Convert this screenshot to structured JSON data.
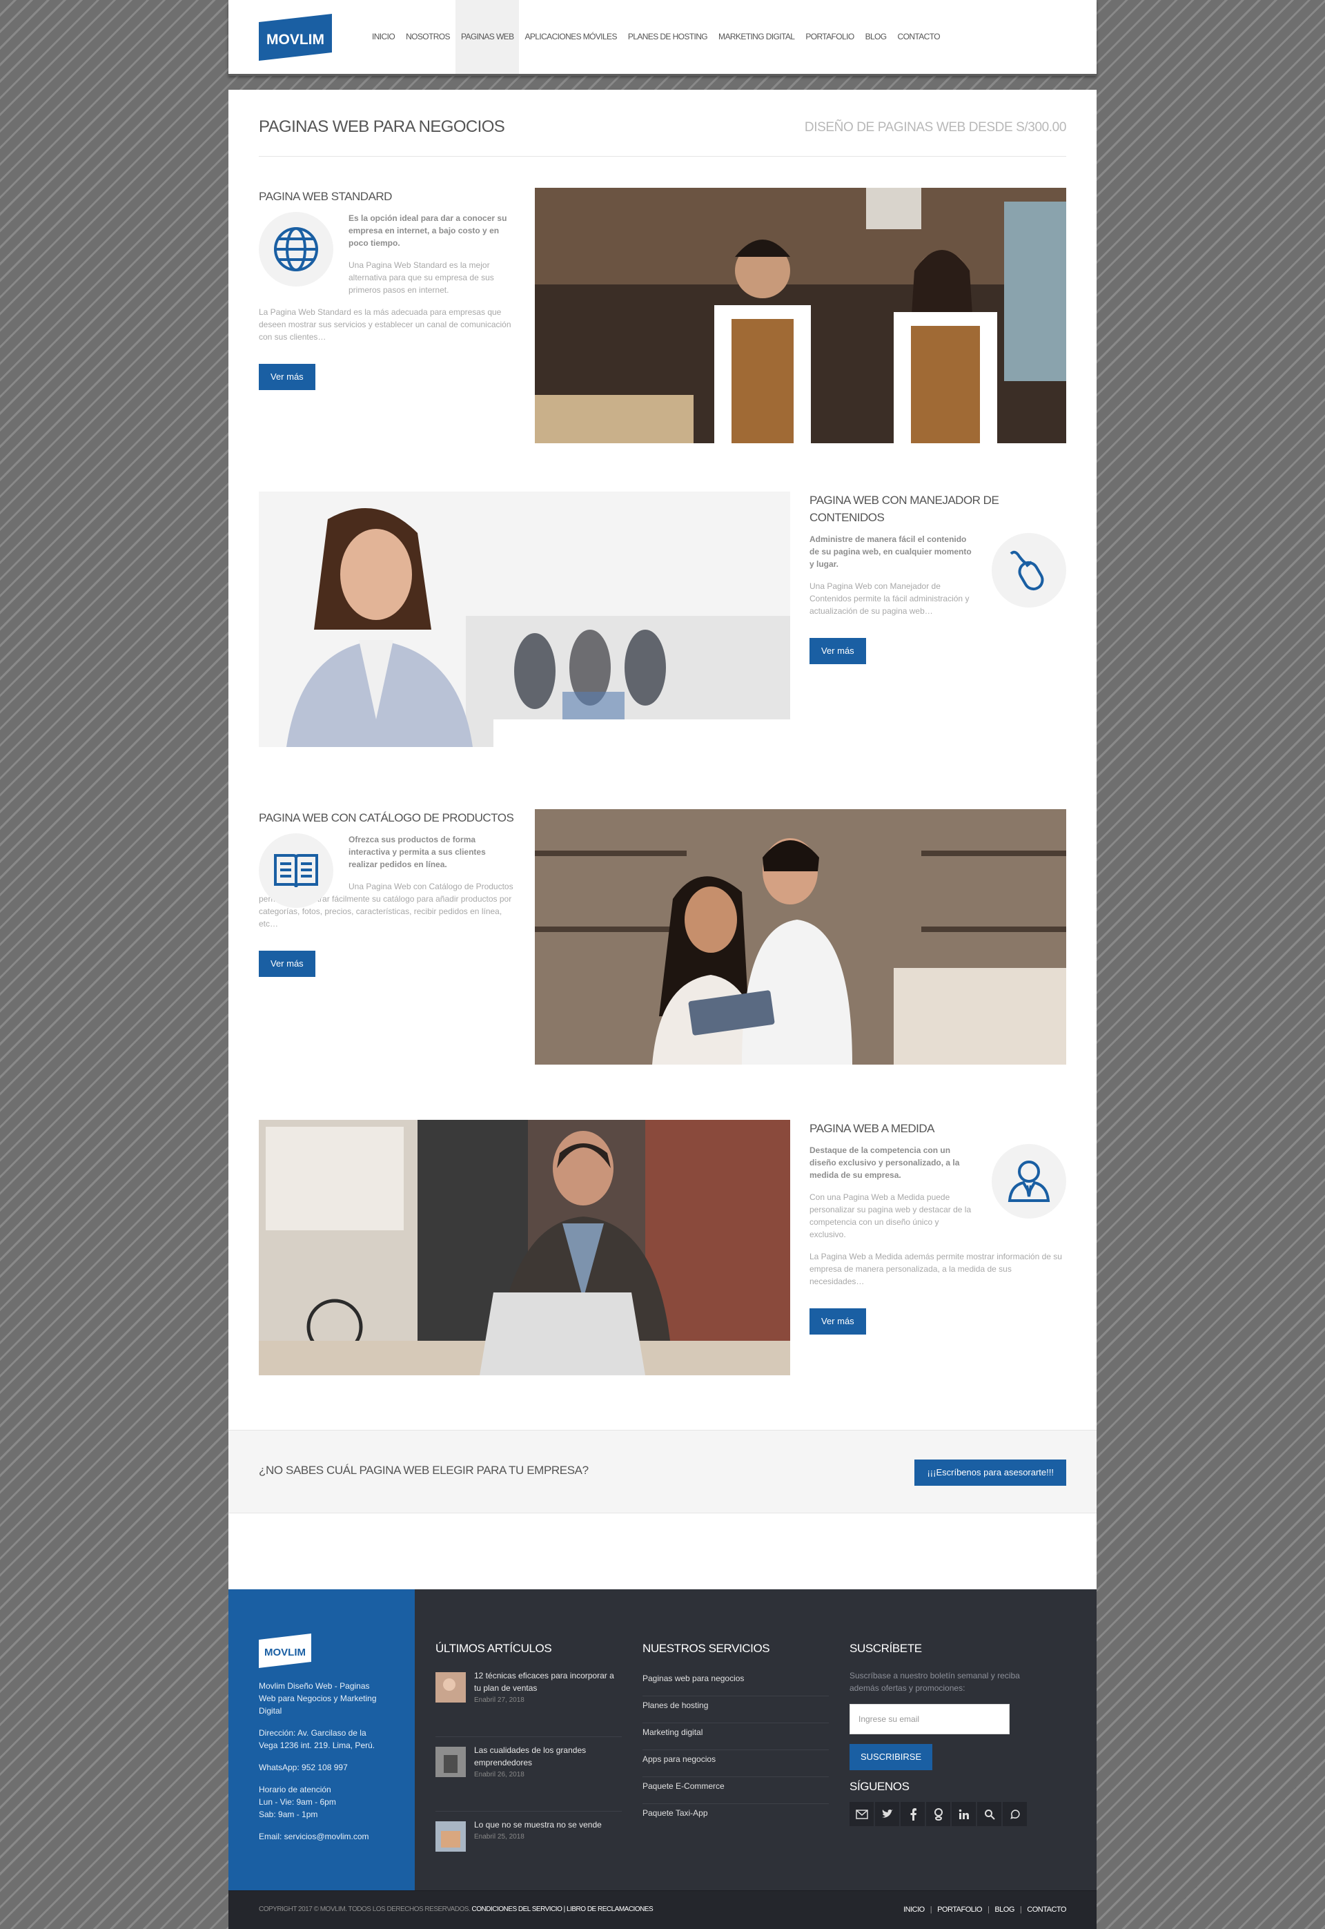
{
  "colors": {
    "brand_blue": "#1a5fa3",
    "footer_dark": "#2e3138",
    "bar_gray": "#f5f5f5"
  },
  "brand": {
    "logo_text": "MOVLIM"
  },
  "nav": {
    "items": [
      "INICIO",
      "NOSOTROS",
      "PAGINAS WEB",
      "APLICACIONES MÓVILES",
      "PLANES DE HOSTING",
      "MARKETING DIGITAL",
      "PORTAFOLIO",
      "BLOG",
      "CONTACTO"
    ],
    "active_index": 2
  },
  "page": {
    "title": "PAGINAS WEB PARA NEGOCIOS",
    "subtitle": "DISEÑO DE PAGINAS WEB DESDE S/300.00"
  },
  "sections": [
    {
      "title": "PAGINA WEB STANDARD",
      "icon": "globe-icon",
      "lead": "Es la opción ideal para dar a conocer su empresa en internet, a bajo costo y en poco tiempo.",
      "desc1": "Una Pagina Web Standard es la mejor alternativa para que su empresa de sus primeros pasos en internet.",
      "desc2": "La Pagina Web Standard es la más adecuada para empresas que deseen mostrar sus servicios y establecer un canal de comunicación con sus clientes…",
      "button": "Ver más"
    },
    {
      "title": "PAGINA WEB CON MANEJADOR DE CONTENIDOS",
      "icon": "mouse-icon",
      "lead": "Administre de manera fácil el contenido de su pagina web, en cualquier momento y lugar.",
      "desc1": "Una Pagina Web con Manejador de Contenidos permite la fácil administración y actualización de su pagina web…",
      "button": "Ver más"
    },
    {
      "title": "PAGINA WEB CON CATÁLOGO DE PRODUCTOS",
      "icon": "book-icon",
      "lead": "Ofrezca sus productos de forma interactiva y permita a sus clientes realizar pedidos en línea.",
      "desc1": "Una Pagina Web con Catálogo de Productos permite administrar fácilmente su catálogo para añadir productos por categorías, fotos, precios, características, recibir pedidos en línea, etc…",
      "button": "Ver más"
    },
    {
      "title": "PAGINA WEB A MEDIDA",
      "icon": "user-tie-icon",
      "lead": "Destaque de la competencia con un diseño exclusivo y personalizado, a la medida de su empresa.",
      "desc1": "Con una Pagina Web a Medida puede personalizar su pagina web y destacar de la competencia con un diseño único y exclusivo.",
      "desc2": "La Pagina Web a Medida además permite mostrar información de su empresa de manera personalizada, a la medida de sus necesidades…",
      "button": "Ver más"
    }
  ],
  "cta": {
    "text": "¿NO SABES CUÁL PAGINA WEB ELEGIR PARA TU EMPRESA?",
    "button": "¡¡¡Escríbenos para asesorarte!!!"
  },
  "footer": {
    "brand_text": "Movlim Diseño Web - Paginas Web para Negocios y Marketing Digital",
    "address": "Dirección: Av. Garcilaso de la Vega 1236 int. 219. Lima, Perú.",
    "whatsapp": "WhatsApp: 952 108 997",
    "hours_title": "Horario de atención",
    "hours_1": "Lun - Vie: 9am - 6pm",
    "hours_2": "Sab: 9am - 1pm",
    "email": "Email: servicios@movlim.com",
    "articles_heading": "ÚLTIMOS ARTÍCULOS",
    "articles": [
      {
        "title": "12 técnicas eficaces para incorporar a tu plan de ventas",
        "date": "Enabril 27, 2018"
      },
      {
        "title": "Las cualidades de los grandes emprendedores",
        "date": "Enabril 26, 2018"
      },
      {
        "title": "Lo que no se muestra no se vende",
        "date": "Enabril 25, 2018"
      }
    ],
    "services_heading": "NUESTROS SERVICIOS",
    "services": [
      "Paginas web para negocios",
      "Planes de hosting",
      "Marketing digital",
      "Apps para negocios",
      "Paquete E-Commerce",
      "Paquete Taxi-App"
    ],
    "subscribe_heading": "SUSCRÍBETE",
    "subscribe_text": "Suscríbase a nuestro boletín semanal y reciba además ofertas y promociones:",
    "email_placeholder": "Ingrese su email",
    "subscribe_button": "SUSCRIBIRSE",
    "follow_heading": "SÍGUENOS",
    "social_icons": [
      "mail-icon",
      "twitter-icon",
      "facebook-icon",
      "google-plus-icon",
      "linkedin-icon",
      "search-icon",
      "whatsapp-icon"
    ]
  },
  "copyright": {
    "text": "COPYRIGHT 2017 © MOVLIM. TODOS LOS DERECHOS RESERVADOS.",
    "link1": "CONDICIONES DEL SERVICIO",
    "divider": "|",
    "link2": "LIBRO DE RECLAMACIONES",
    "links": [
      "INICIO",
      "PORTAFOLIO",
      "BLOG",
      "CONTACTO"
    ]
  }
}
